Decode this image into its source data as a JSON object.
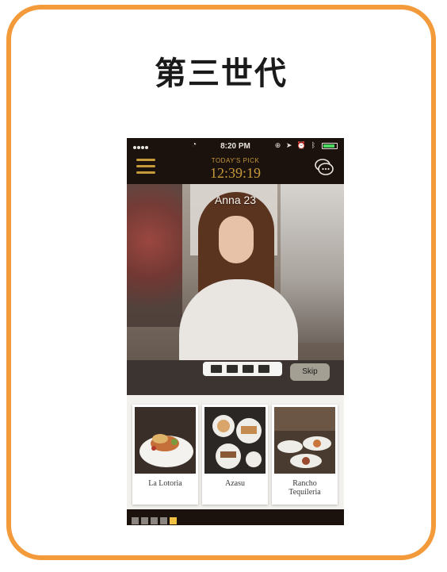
{
  "title": "第三世代",
  "colors": {
    "accent": "#f39a3b",
    "gold": "#c59a3a",
    "dark": "#1c120d"
  },
  "status_bar": {
    "time": "8:20 PM",
    "icons": [
      "signal-dots-icon",
      "wifi-icon",
      "lock-rotation-icon",
      "location-icon",
      "alarm-icon",
      "bluetooth-icon",
      "battery-icon"
    ]
  },
  "app_bar": {
    "pick_label": "TODAY'S PICK",
    "countdown": "12:39:19"
  },
  "profile": {
    "name_age": "Anna 23"
  },
  "skip_label": "Skip",
  "restaurants": [
    {
      "name": "La Lotoria"
    },
    {
      "name": "Azasu"
    },
    {
      "name": "Rancho Tequileria"
    }
  ],
  "pagination": {
    "total": 5,
    "active_index": 4
  }
}
